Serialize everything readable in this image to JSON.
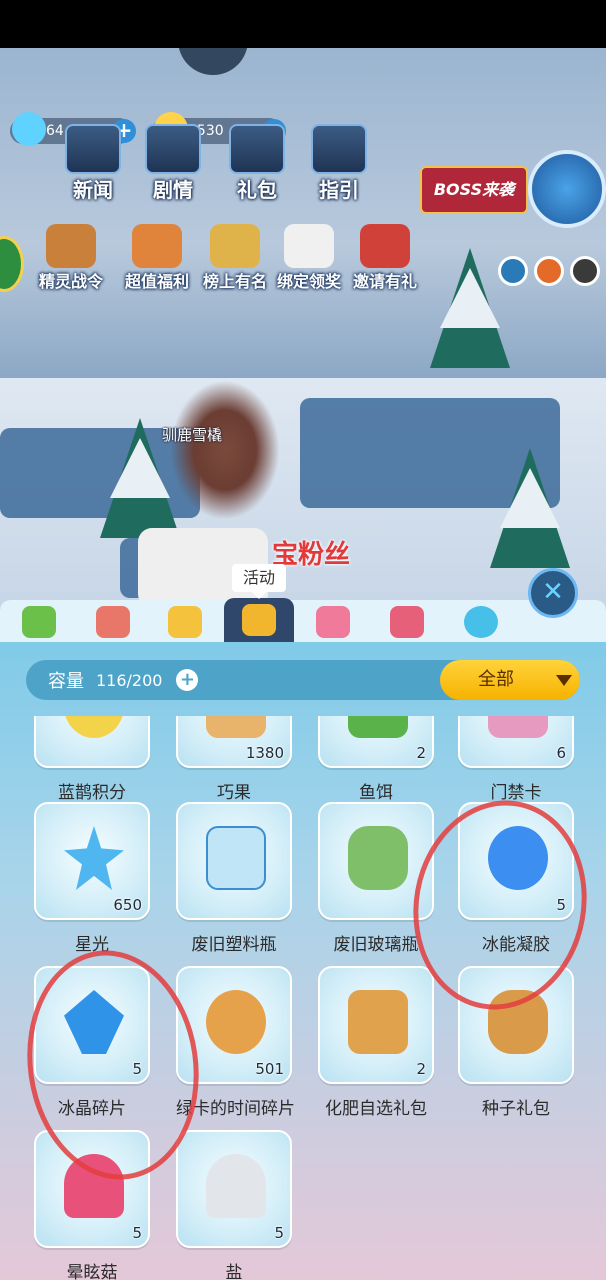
{
  "hud": {
    "gems": "64",
    "coins": "6530"
  },
  "top_menu": [
    {
      "label": "新闻"
    },
    {
      "label": "剧情"
    },
    {
      "label": "礼包"
    },
    {
      "label": "指引"
    }
  ],
  "boss_banner": "BOSS来袭",
  "events": [
    {
      "label": "精灵战令"
    },
    {
      "label": "超值福利"
    },
    {
      "label": "榜上有名"
    },
    {
      "label": "绑定领奖"
    },
    {
      "label": "邀请有礼"
    }
  ],
  "npc_name": "驯鹿雪橇",
  "fans_text": "宝粉丝",
  "tooltip": "活动",
  "capacity": {
    "label": "容量",
    "value": "116/200"
  },
  "filter": "全部",
  "items": [
    {
      "name": "蓝鹊积分",
      "count": ""
    },
    {
      "name": "巧果",
      "count": "1380"
    },
    {
      "name": "鱼饵",
      "count": "2"
    },
    {
      "name": "门禁卡",
      "count": "6"
    },
    {
      "name": "星光",
      "count": "650"
    },
    {
      "name": "废旧塑料瓶",
      "count": ""
    },
    {
      "name": "废旧玻璃瓶",
      "count": ""
    },
    {
      "name": "冰能凝胶",
      "count": "5"
    },
    {
      "name": "冰晶碎片",
      "count": "5"
    },
    {
      "name": "绿卡的时间碎片",
      "count": "501"
    },
    {
      "name": "化肥自选礼包",
      "count": "2"
    },
    {
      "name": "种子礼包",
      "count": ""
    },
    {
      "name": "晕眩菇",
      "count": "5"
    },
    {
      "name": "盐",
      "count": "5"
    }
  ],
  "colors": {
    "panel_top": "#79c9e8",
    "panel_bottom": "#e4c8d8",
    "filter_gold": "#ffd33a",
    "annotation_red": "#e33d3d"
  }
}
